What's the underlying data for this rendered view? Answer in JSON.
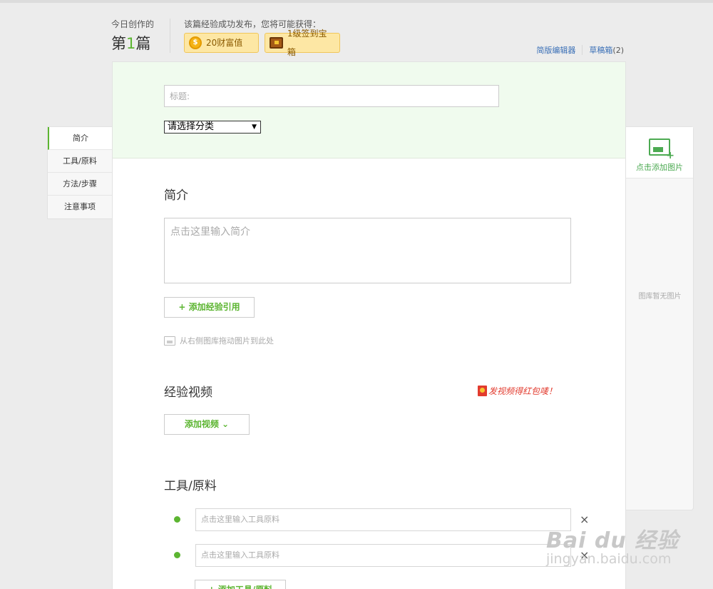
{
  "header": {
    "today_label": "今日创作的",
    "count_prefix": "第",
    "count_number": "1",
    "count_suffix": "篇",
    "reward_label": "该篇经验成功发布，您将可能获得：",
    "reward_coins": "20财富值",
    "reward_chest": "1级签到宝箱",
    "link_simple_editor": "简版编辑器",
    "link_drafts": "草稿箱",
    "drafts_count": "(2)"
  },
  "left_nav": {
    "items": [
      "简介",
      "工具/原料",
      "方法/步骤",
      "注意事项"
    ]
  },
  "form": {
    "title_placeholder": "标题:",
    "category_value": "请选择分类",
    "intro_title": "简介",
    "intro_placeholder": "点击这里输入简介",
    "add_reference": "+ 添加经验引用",
    "drag_hint": "从右侧图库拖动图片到此处",
    "video_title": "经验视频",
    "video_promo": "发视频得红包唛！",
    "add_video": "添加视频 ⌄",
    "tools_title": "工具/原料",
    "tool_placeholder": "点击这里输入工具原料",
    "tool_remove": "×",
    "add_tool": "+ 添加工具/原料"
  },
  "gallery": {
    "add_image": "点击添加图片",
    "empty": "图库暂无图片"
  },
  "watermark": {
    "main": "Bai du 经验",
    "sub": "jingyan.baidu.com"
  }
}
